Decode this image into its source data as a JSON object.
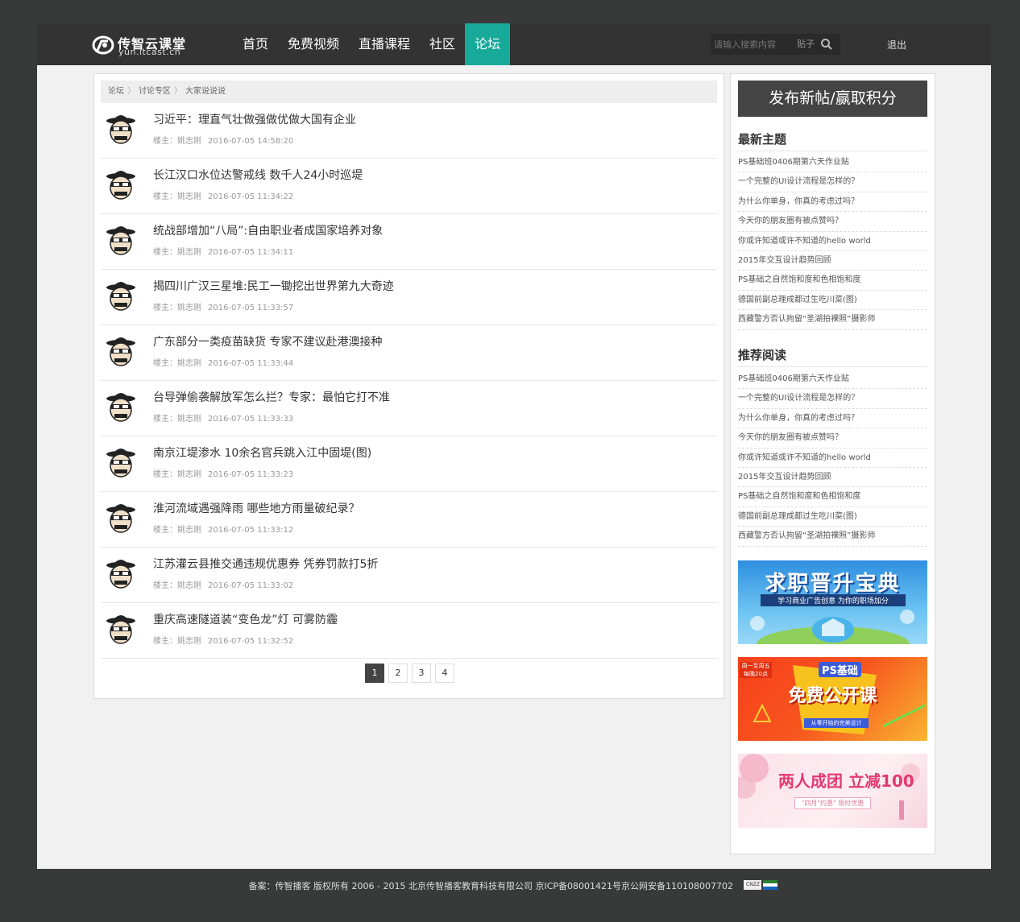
{
  "header": {
    "logo_title": "传智云课堂",
    "logo_sub": "yun.itcast.cn",
    "nav": [
      {
        "label": "首页",
        "active": false
      },
      {
        "label": "免费视频",
        "active": false
      },
      {
        "label": "直播课程",
        "active": false
      },
      {
        "label": "社区",
        "active": false
      },
      {
        "label": "论坛",
        "active": true
      }
    ],
    "search_placeholder": "请输入搜索内容",
    "search_category": "贴子",
    "logout": "退出"
  },
  "breadcrumb": [
    "论坛",
    "讨论专区",
    "大家说说说"
  ],
  "posts": [
    {
      "title": "习近平：理直气壮做强做优做大国有企业",
      "author": "楼主：姚志刚",
      "time": "2016-07-05 14:58:20"
    },
    {
      "title": "长江汉口水位达警戒线 数千人24小时巡堤",
      "author": "楼主：姚志刚",
      "time": "2016-07-05 11:34:22"
    },
    {
      "title": "统战部增加“八局”:自由职业者成国家培养对象",
      "author": "楼主：姚志刚",
      "time": "2016-07-05 11:34:11"
    },
    {
      "title": "揭四川广汉三星堆:民工一锄挖出世界第九大奇迹",
      "author": "楼主：姚志刚",
      "time": "2016-07-05 11:33:57"
    },
    {
      "title": "广东部分一类疫苗缺货 专家不建议赴港澳接种",
      "author": "楼主：姚志刚",
      "time": "2016-07-05 11:33:44"
    },
    {
      "title": "台导弹偷袭解放军怎么拦？专家：最怕它打不准",
      "author": "楼主：姚志刚",
      "time": "2016-07-05 11:33:33"
    },
    {
      "title": "南京江堤渗水 10余名官兵跳入江中固堤(图)",
      "author": "楼主：姚志刚",
      "time": "2016-07-05 11:33:23"
    },
    {
      "title": "淮河流域遇强降雨 哪些地方雨量破纪录？",
      "author": "楼主：姚志刚",
      "time": "2016-07-05 11:33:12"
    },
    {
      "title": "江苏灌云县推交通违规优惠券 凭券罚款打5折",
      "author": "楼主：姚志刚",
      "time": "2016-07-05 11:33:02"
    },
    {
      "title": "重庆高速隧道装“变色龙”灯 可雾防霾",
      "author": "楼主：姚志刚",
      "time": "2016-07-05 11:32:52"
    }
  ],
  "pagination": {
    "pages": [
      "1",
      "2",
      "3",
      "4"
    ],
    "current": "1"
  },
  "sidebar": {
    "publish_button": "发布新帖/赢取积分",
    "latest_title": "最新主题",
    "latest": [
      "PS基础班0406期第六天作业贴",
      "一个完整的UI设计流程是怎样的？",
      "为什么你单身，你真的考虑过吗？",
      "今天你的朋友圈有被点赞吗？",
      "你或许知道或许不知道的hello world",
      "2015年交互设计趋势回顾",
      "PS基础之自然饱和度和色相饱和度",
      "德国前副总理成都过生吃川菜(图)",
      "西藏警方否认拘留“圣湖拍裸照”摄影师"
    ],
    "recommend_title": "推荐阅读",
    "recommend": [
      "PS基础班0406期第六天作业贴",
      "一个完整的UI设计流程是怎样的？",
      "为什么你单身，你真的考虑过吗？",
      "今天你的朋友圈有被点赞吗？",
      "你或许知道或许不知道的hello world",
      "2015年交互设计趋势回顾",
      "PS基础之自然饱和度和色相饱和度",
      "德国前副总理成都过生吃川菜(图)",
      "西藏警方否认拘留“圣湖拍裸照”摄影师"
    ],
    "banners": [
      {
        "headline": "求职晋升宝典",
        "sub": "学习商业广告创意 为你的职场加分"
      },
      {
        "headline": "免费公开课",
        "sub": "PS基础",
        "corner": "周一至周五 每晚20点",
        "tag": "从零开始的完美设计"
      },
      {
        "headline": "两人成团 立减100",
        "sub": "\"四月\"约惠\" 限时优惠"
      }
    ]
  },
  "footer": {
    "text": "备案：传智播客  版权所有 2006 - 2015 北京传智播客教育科技有限公司   京ICP备08001421号京公网安备110108007702",
    "badge": "CNZZ"
  },
  "colors": {
    "accent": "#17a99a",
    "header": "#333333",
    "body": "#383a39"
  }
}
